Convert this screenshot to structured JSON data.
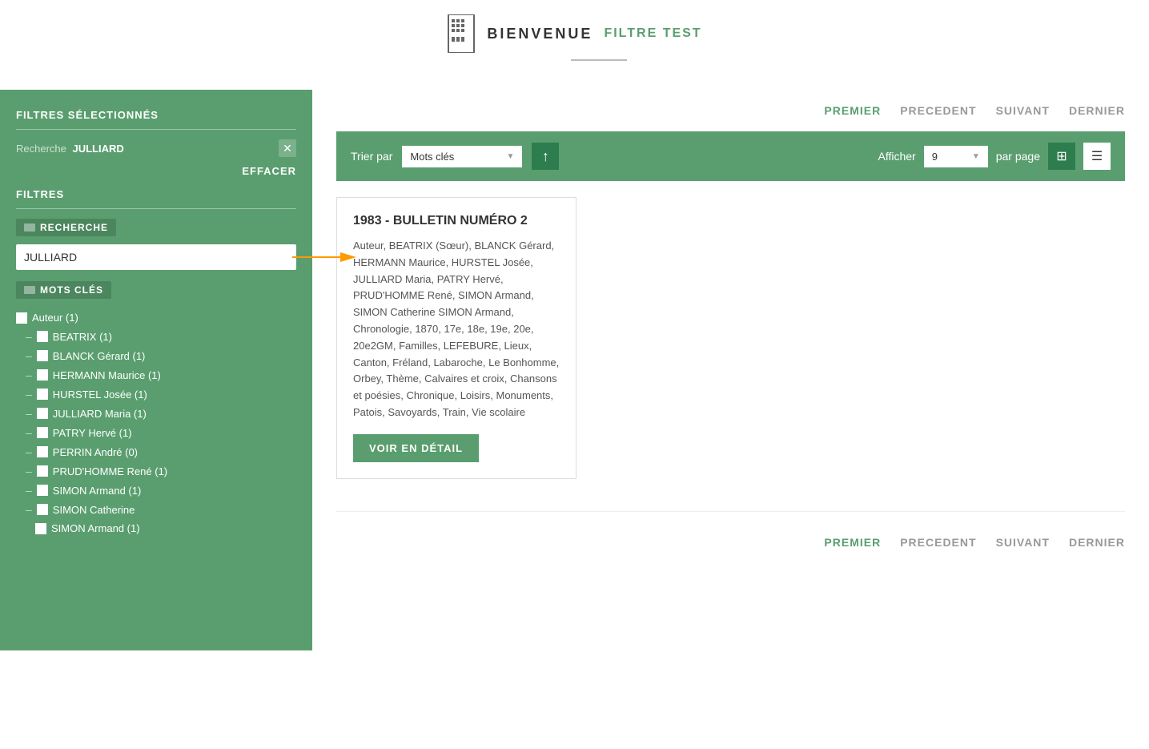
{
  "header": {
    "title": "BIENVENUE",
    "link": "FILTRE TEST"
  },
  "sidebar": {
    "section_title": "FILTRES SÉLECTIONNÉS",
    "search_label": "Recherche",
    "search_value": "JULLIARD",
    "effacer_label": "EFFACER",
    "filtres_label": "FILTRES",
    "recherche_badge": "RECHERCHE",
    "search_input_value": "JULLIARD",
    "mots_cles_badge": "MOTS CLÉS",
    "filter_items": [
      {
        "label": "Auteur (1)",
        "level": "parent",
        "checked": false
      },
      {
        "label": "BEATRIX (1)",
        "level": "child",
        "checked": false
      },
      {
        "label": "BLANCK Gérard (1)",
        "level": "child",
        "checked": false
      },
      {
        "label": "HERMANN Maurice (1)",
        "level": "child",
        "checked": false
      },
      {
        "label": "HURSTEL Josée (1)",
        "level": "child",
        "checked": false
      },
      {
        "label": "JULLIARD Maria (1)",
        "level": "child",
        "checked": false
      },
      {
        "label": "PATRY Hervé (1)",
        "level": "child",
        "checked": false
      },
      {
        "label": "PERRIN André (0)",
        "level": "child",
        "checked": false
      },
      {
        "label": "PRUD'HOMME René (1)",
        "level": "child",
        "checked": false
      },
      {
        "label": "SIMON Armand (1)",
        "level": "child",
        "checked": false
      },
      {
        "label": "SIMON Catherine",
        "level": "child",
        "checked": false
      },
      {
        "label": "SIMON Armand (1)",
        "level": "sub-child",
        "checked": false
      }
    ]
  },
  "toolbar": {
    "trier_label": "Trier par",
    "sort_value": "Mots clés",
    "afficher_label": "Afficher",
    "per_page_value": "9",
    "par_page_label": "par page"
  },
  "pagination": {
    "premier": "PREMIER",
    "precedent": "PRECEDENT",
    "suivant": "SUIVANT",
    "dernier": "DERNIER"
  },
  "card": {
    "title": "1983 - BULLETIN NUMÉRO 2",
    "body": "Auteur, BEATRIX (Sœur), BLANCK Gérard, HERMANN Maurice, HURSTEL Josée, JULLIARD Maria, PATRY Hervé, PRUD'HOMME René, SIMON Armand, SIMON Catherine SIMON Armand, Chronologie, 1870, 17e, 18e, 19e, 20e, 20e2GM, Familles, LEFEBURE, Lieux, Canton, Fréland, Labaroche, Le Bonhomme, Orbey, Thème, Calvaires et croix, Chansons et poésies, Chronique, Loisirs, Monuments, Patois, Savoyards, Train, Vie scolaire",
    "btn_label": "VOIR EN DÉTAIL"
  }
}
